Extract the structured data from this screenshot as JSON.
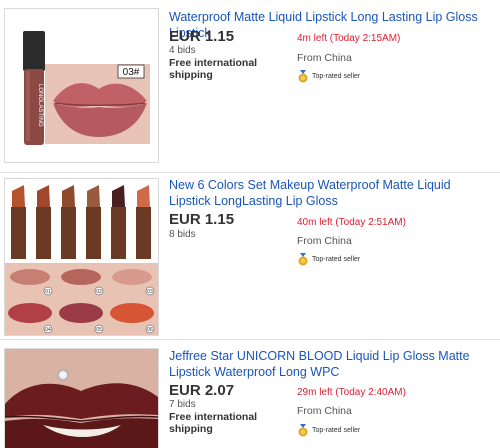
{
  "listings": [
    {
      "title": "Waterproof Matte Liquid Lipstick Long Lasting Lip Gloss Lipstick",
      "price": "EUR 1.15",
      "bids": "4 bids",
      "shipping": "Free international shipping",
      "time_left": "4m left (Today 2:15AM)",
      "origin": "From China",
      "seller_badge": "Top-rated seller",
      "image_badge": "03#",
      "image_brand": "LONGLASTING",
      "image_colors": {
        "lips": "#b55a5e",
        "tube": "#8d4a45",
        "skin": "#e7c4b5"
      }
    },
    {
      "title": "New 6 Colors Set Makeup Waterproof Matte Liquid Lipstick LongLasting Lip Gloss",
      "price": "EUR 1.15",
      "bids": "8 bids",
      "shipping": "",
      "time_left": "40m left (Today 2:51AM)",
      "origin": "From China",
      "seller_badge": "Top-rated seller",
      "swatch_numbers": [
        "01",
        "02",
        "03",
        "04",
        "05",
        "06"
      ],
      "image_colors": {
        "sticks": [
          "#b5532f",
          "#a1482c",
          "#8e4a2e",
          "#9a5a3c",
          "#4a1f1f",
          "#d0694a"
        ],
        "lips": [
          "#c87f73",
          "#b5655c",
          "#d89a8c",
          "#b04045",
          "#9a3b45",
          "#d65535"
        ]
      }
    },
    {
      "title": "Jeffree Star UNICORN BLOOD Liquid Lip Gloss Matte Lipstick Waterproof Long WPC",
      "price": "EUR 2.07",
      "bids": "7 bids",
      "shipping": "Free international shipping",
      "time_left": "29m left (Today 2:40AM)",
      "origin": "From China",
      "seller_badge": "Top-rated seller",
      "image_colors": {
        "lips": "#6a1c1e",
        "skin": "#d9b2a3"
      }
    }
  ],
  "colors": {
    "link": "#1a55b8",
    "time_left": "#dd1e31",
    "medal": "#e0a81c"
  }
}
